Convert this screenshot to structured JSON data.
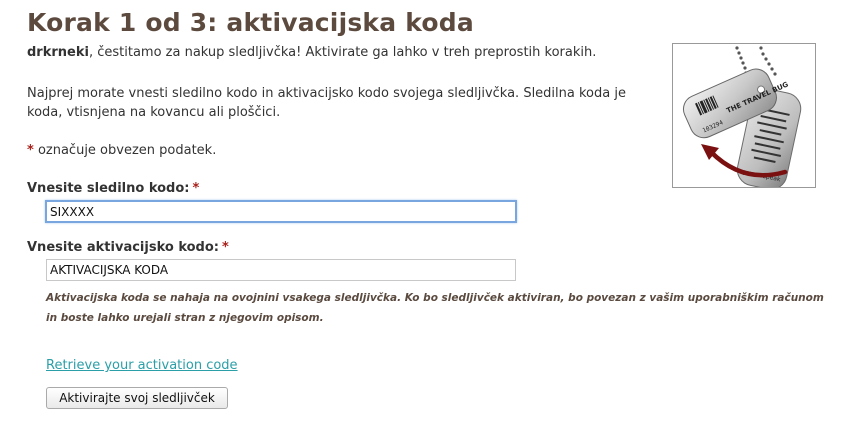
{
  "page": {
    "title": "Korak 1 od 3: aktivacijska koda",
    "username": "drkrneki",
    "intro_rest": ", čestitamo za nakup sledljivčka! Aktivirate ga lahko v treh preprostih korakih.",
    "instructions": "Najprej morate vnesti sledilno kodo in aktivacijsko kodo svojega sledljivčka. Sledilna koda je koda, vtisnjena na kovancu ali ploščici.",
    "required_star": "*",
    "required_note": " označuje obvezen podatek."
  },
  "form": {
    "tracking_label": "Vnesite sledilno kodo:",
    "tracking_value": "SIXXXX",
    "activation_label": "Vnesite aktivacijsko kodo:",
    "activation_value": "AKTIVACIJSKA KODA",
    "activation_hint": "Aktivacijska koda se nahaja na ovojnini vsakega sledljivčka. Ko bo sledljivček aktiviran, bo povezan z vašim uporabniškim računom in boste lahko urejali stran z njegovim opisom.",
    "retrieve_link": "Retrieve your activation code",
    "submit_label": "Aktivirajte svoj sledljivček"
  },
  "image": {
    "tag_text": "THE TRAVEL BUG",
    "tag_number": "103294",
    "brand": "groundspeak"
  },
  "colors": {
    "title": "#5c4a3e",
    "required": "#a8201a",
    "link": "#2a9fa8",
    "arrow": "#7a1010",
    "focus_border": "#7aa6e0"
  }
}
